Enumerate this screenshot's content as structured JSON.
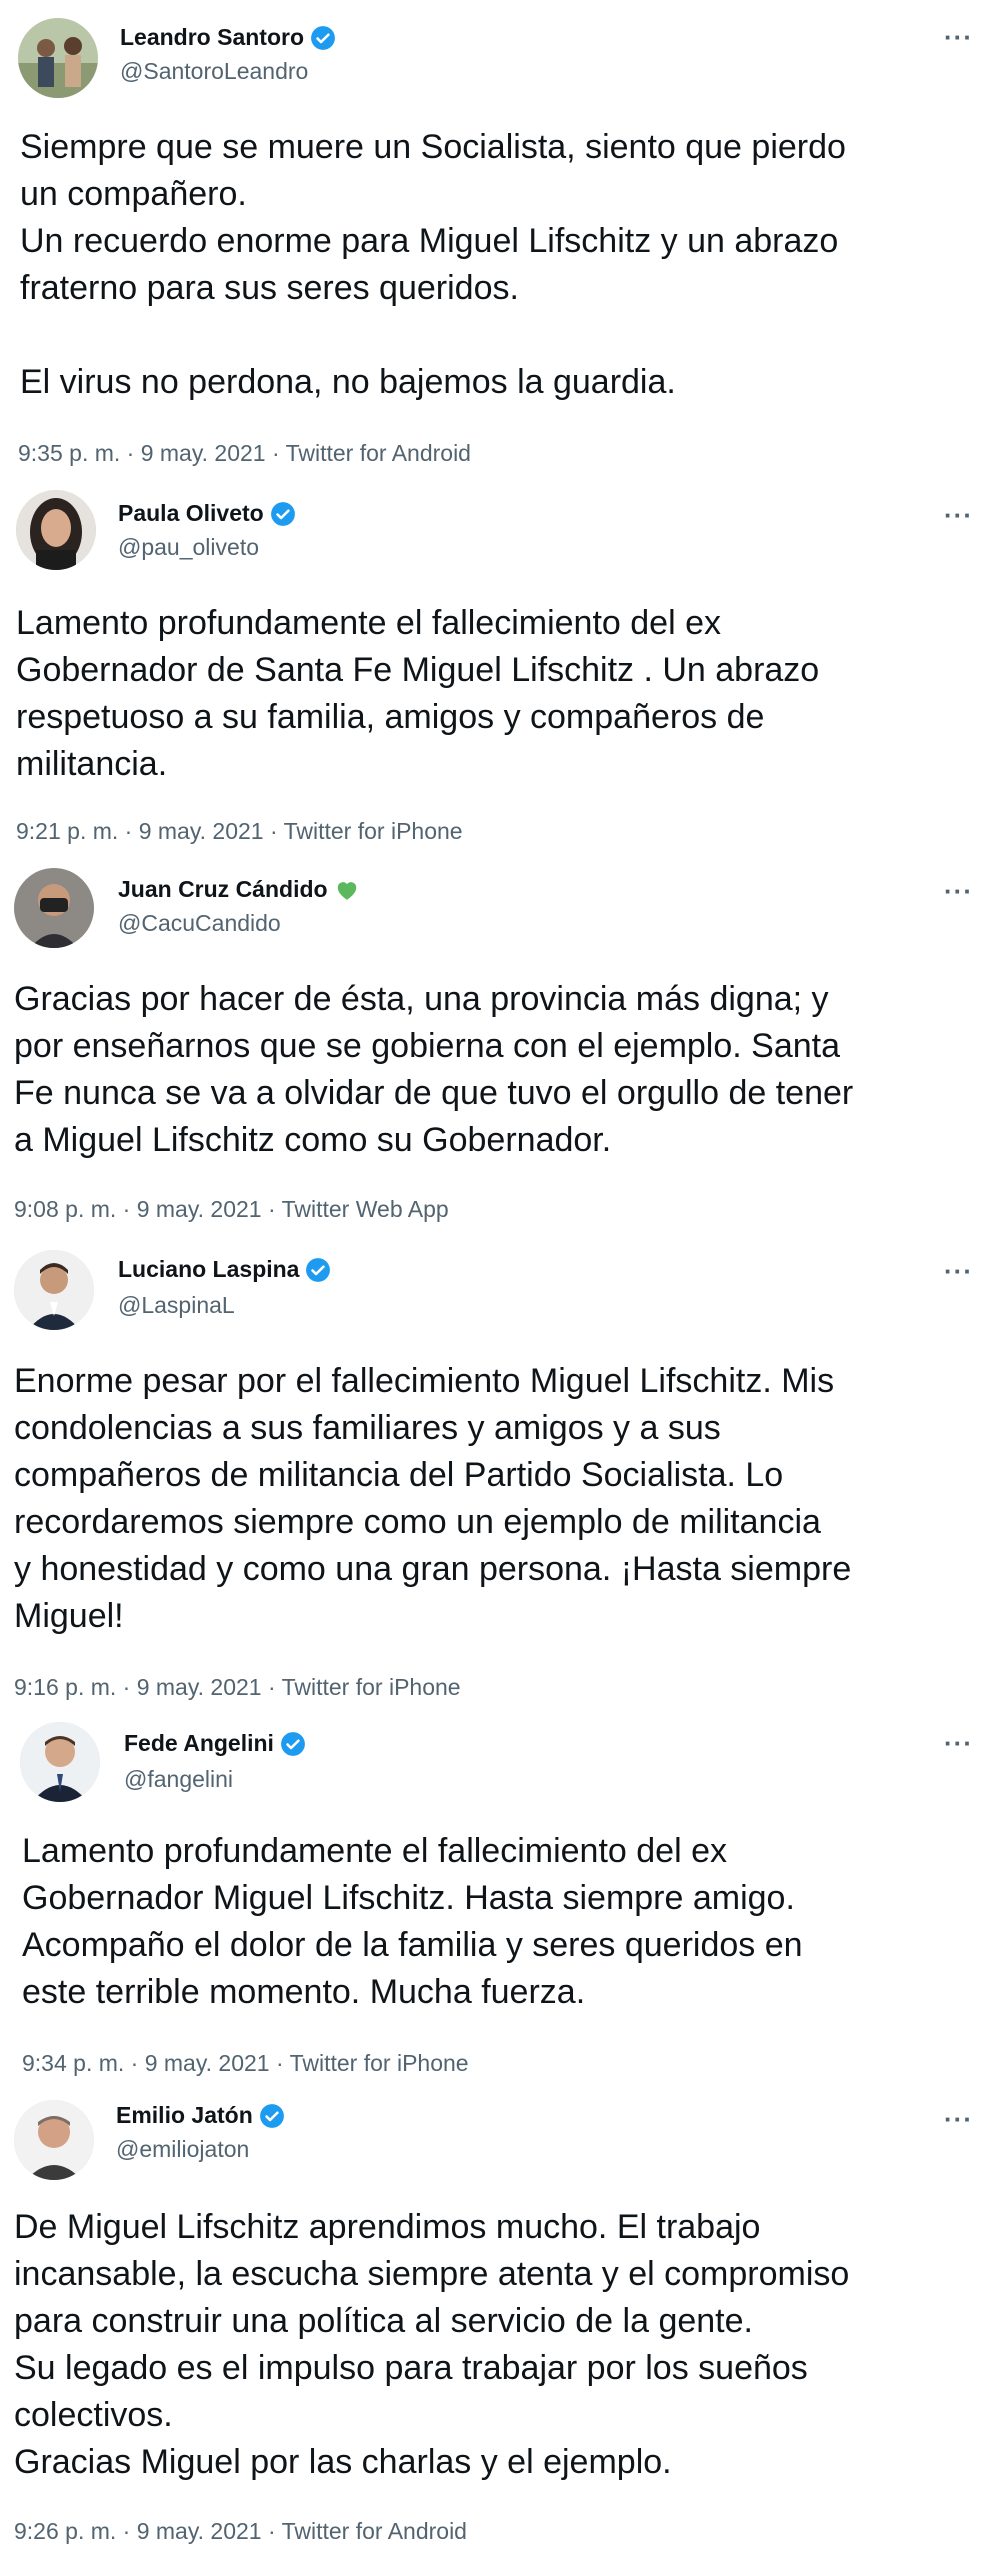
{
  "tweets": [
    {
      "name": "Leandro Santoro",
      "handle": "@SantoroLeandro",
      "badge": "verified-badge",
      "text": "Siempre que se muere un Socialista, siento que pierdo\nun compañero.\nUn recuerdo enorme para Miguel Lifschitz y un abrazo\nfraterno para sus seres queridos.\n\nEl virus no perdona, no bajemos la guardia.",
      "meta": "9:35 p. m. · 9 may. 2021 · Twitter for Android",
      "more": "···"
    },
    {
      "name": "Paula Oliveto",
      "handle": "@pau_oliveto",
      "badge": "verified-badge",
      "text": "Lamento profundamente el fallecimiento del ex\nGobernador de Santa Fe Miguel Lifschitz . Un abrazo\nrespetuoso a su familia, amigos y compañeros de\nmilitancia.",
      "meta": "9:21 p. m. · 9 may. 2021 · Twitter for iPhone",
      "more": "···"
    },
    {
      "name": "Juan Cruz Cándido",
      "handle": "@CacuCandido",
      "badge": "green-heart",
      "text": "Gracias por hacer de ésta, una provincia más digna; y\npor enseñarnos que se gobierna con el ejemplo. Santa\nFe nunca se va a olvidar de que tuvo el orgullo de tener\na Miguel Lifschitz como su Gobernador.",
      "meta": "9:08 p. m. · 9 may. 2021 · Twitter Web App",
      "more": "···"
    },
    {
      "name": "Luciano Laspina",
      "handle": "@LaspinaL",
      "badge": "verified-badge",
      "text": "Enorme pesar por el fallecimiento Miguel Lifschitz. Mis\ncondolencias a sus familiares y amigos y a sus\ncompañeros de militancia del Partido Socialista. Lo\nrecordaremos  siempre como un ejemplo de militancia\ny honestidad y como una gran persona. ¡Hasta siempre\nMiguel!",
      "meta": "9:16 p. m. · 9 may. 2021 · Twitter for iPhone",
      "more": "···"
    },
    {
      "name": "Fede Angelini",
      "handle": "@fangelini",
      "badge": "verified-badge",
      "text": "Lamento profundamente el fallecimiento del ex\nGobernador Miguel Lifschitz. Hasta siempre amigo.\nAcompaño el dolor de la familia y seres queridos en\neste terrible momento. Mucha fuerza.",
      "meta": "9:34 p. m. · 9 may. 2021 · Twitter for iPhone",
      "more": "···"
    },
    {
      "name": "Emilio Jatón",
      "handle": "@emiliojaton",
      "badge": "verified-badge",
      "text": "De Miguel Lifschitz aprendimos mucho. El trabajo\nincansable, la escucha siempre atenta y el compromiso\npara construir una política al servicio de la gente.\nSu legado es el impulso para trabajar por los sueños\ncolectivos.\nGracias Miguel por las charlas y el ejemplo.",
      "meta": "9:26 p. m. · 9 may. 2021 · Twitter for Android",
      "more": "···"
    }
  ],
  "colors": {
    "text": "#0f1419",
    "secondary": "#536471",
    "verified": "#1d9bf0",
    "green_heart": "#5cb85c"
  }
}
